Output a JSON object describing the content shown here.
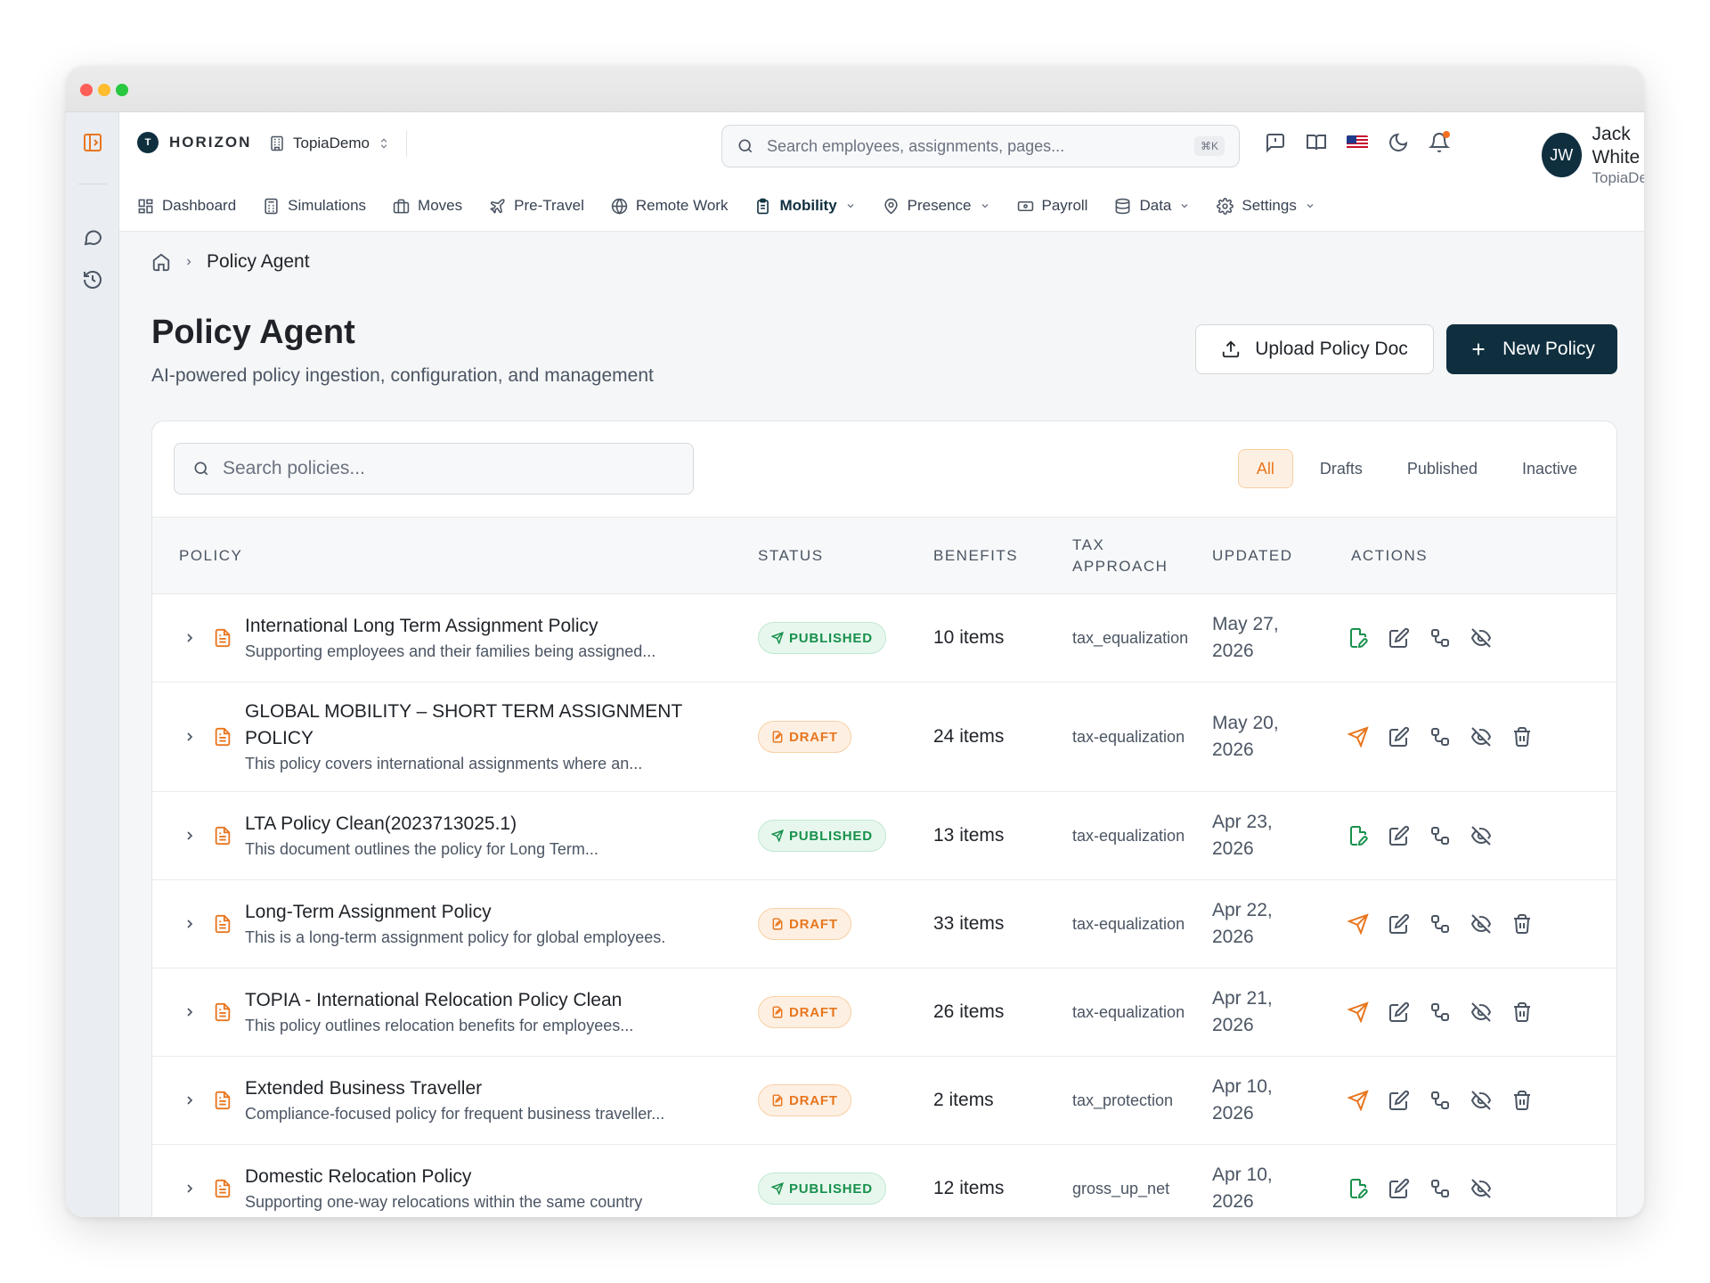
{
  "app": {
    "brand": "HORIZON",
    "org_selector": "TopiaDemo",
    "search_placeholder": "Search employees, assignments, pages...",
    "search_shortcut": "⌘K",
    "user": {
      "initials": "JW",
      "name": "Jack White",
      "org": "TopiaDemo"
    }
  },
  "nav": {
    "items": [
      {
        "label": "Dashboard"
      },
      {
        "label": "Simulations"
      },
      {
        "label": "Moves"
      },
      {
        "label": "Pre-Travel"
      },
      {
        "label": "Remote Work"
      },
      {
        "label": "Mobility",
        "active": true
      },
      {
        "label": "Presence"
      },
      {
        "label": "Payroll"
      },
      {
        "label": "Data"
      },
      {
        "label": "Settings"
      }
    ]
  },
  "breadcrumb": {
    "current": "Policy Agent"
  },
  "page": {
    "title": "Policy Agent",
    "subtitle": "AI-powered policy ingestion, configuration, and management",
    "upload_label": "Upload Policy Doc",
    "new_label": "New Policy"
  },
  "filters": {
    "search_placeholder": "Search policies...",
    "tabs": [
      "All",
      "Drafts",
      "Published",
      "Inactive"
    ],
    "active_tab": "All"
  },
  "table": {
    "columns": {
      "policy": "POLICY",
      "status": "STATUS",
      "benefits": "BENEFITS",
      "tax_1": "TAX",
      "tax_2": "APPROACH",
      "updated": "UPDATED",
      "actions": "ACTIONS"
    },
    "rows": [
      {
        "name": "International Long Term Assignment Policy",
        "name_2": "",
        "desc": "Supporting employees and their families being assigned...",
        "status": "PUBLISHED",
        "benefits": "10 items",
        "tax": "tax_equalization",
        "updated_1": "May 27,",
        "updated_2": "2026"
      },
      {
        "name": "GLOBAL MOBILITY – SHORT TERM ASSIGNMENT",
        "name_2": "POLICY",
        "desc": "This policy covers international assignments where an...",
        "status": "DRAFT",
        "benefits": "24 items",
        "tax": "tax-equalization",
        "updated_1": "May 20,",
        "updated_2": "2026"
      },
      {
        "name": "LTA Policy Clean(2023713025.1)",
        "name_2": "",
        "desc": "This document outlines the policy for Long Term...",
        "status": "PUBLISHED",
        "benefits": "13 items",
        "tax": "tax-equalization",
        "updated_1": "Apr 23,",
        "updated_2": "2026"
      },
      {
        "name": "Long-Term Assignment Policy",
        "name_2": "",
        "desc": "This is a long-term assignment policy for global employees.",
        "status": "DRAFT",
        "benefits": "33 items",
        "tax": "tax-equalization",
        "updated_1": "Apr 22,",
        "updated_2": "2026"
      },
      {
        "name": "TOPIA - International Relocation Policy Clean",
        "name_2": "",
        "desc": "This policy outlines relocation benefits for employees...",
        "status": "DRAFT",
        "benefits": "26 items",
        "tax": "tax-equalization",
        "updated_1": "Apr 21,",
        "updated_2": "2026"
      },
      {
        "name": "Extended Business Traveller",
        "name_2": "",
        "desc": "Compliance-focused policy for frequent business traveller...",
        "status": "DRAFT",
        "benefits": "2 items",
        "tax": "tax_protection",
        "updated_1": "Apr 10,",
        "updated_2": "2026"
      },
      {
        "name": "Domestic Relocation Policy",
        "name_2": "",
        "desc": "Supporting one-way relocations within the same country",
        "status": "PUBLISHED",
        "benefits": "12 items",
        "tax": "gross_up_net",
        "updated_1": "Apr 10,",
        "updated_2": "2026"
      }
    ]
  },
  "colors": {
    "brand": "#0f2f3f",
    "accent": "#e8761f",
    "published": "#17914c"
  }
}
